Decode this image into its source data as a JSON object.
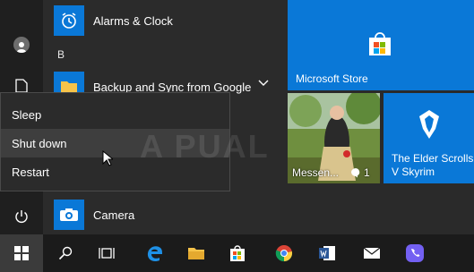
{
  "start_menu": {
    "section_letter": "B",
    "apps": [
      {
        "label": "Alarms & Clock",
        "icon": "clock-icon"
      },
      {
        "label": "Backup and Sync from Google",
        "icon": "folder-icon"
      },
      {
        "label": "Camera",
        "icon": "camera-icon"
      }
    ]
  },
  "power_menu": {
    "items": [
      {
        "label": "Sleep"
      },
      {
        "label": "Shut down"
      },
      {
        "label": "Restart"
      }
    ],
    "hovered": "Shut down"
  },
  "watermark": "A PUAL",
  "tiles": {
    "store": {
      "label": "Microsoft Store"
    },
    "messenger": {
      "label": "Messen...",
      "badge": "1"
    },
    "skyrim": {
      "label": "The Elder Scrolls V Skyrim"
    }
  },
  "colors": {
    "accent": "#0a78d7",
    "taskbar": "#1b1b1b",
    "menu_bg": "#2b2b2b"
  },
  "taskbar_icons": [
    "start-icon",
    "search-icon",
    "task-view-icon",
    "edge-icon",
    "file-explorer-icon",
    "store-icon",
    "chrome-icon",
    "word-icon",
    "mail-icon",
    "viber-icon"
  ]
}
